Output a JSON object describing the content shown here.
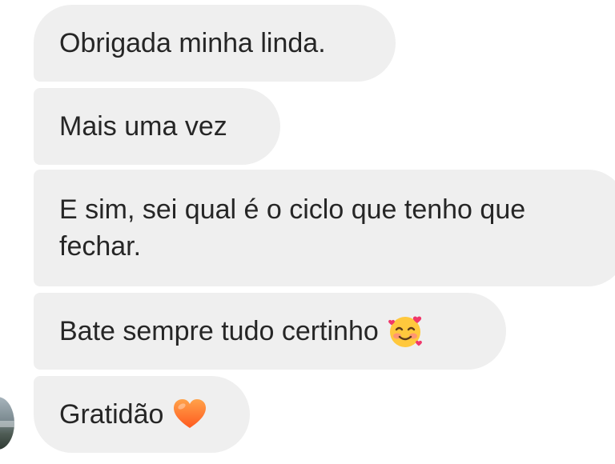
{
  "messages": [
    {
      "text": "Obrigada minha linda.",
      "emoji": ""
    },
    {
      "text": "Mais uma vez",
      "emoji": ""
    },
    {
      "text": "E sim, sei qual é o ciclo que tenho que fechar.",
      "emoji": ""
    },
    {
      "text": "Bate sempre tudo certinho",
      "emoji": "smiling-face-with-hearts"
    },
    {
      "text": "Gratidão",
      "emoji": "orange-heart"
    }
  ],
  "colors": {
    "bubble": "#efefef",
    "text": "#262626",
    "heart": "#ff7a1a"
  }
}
